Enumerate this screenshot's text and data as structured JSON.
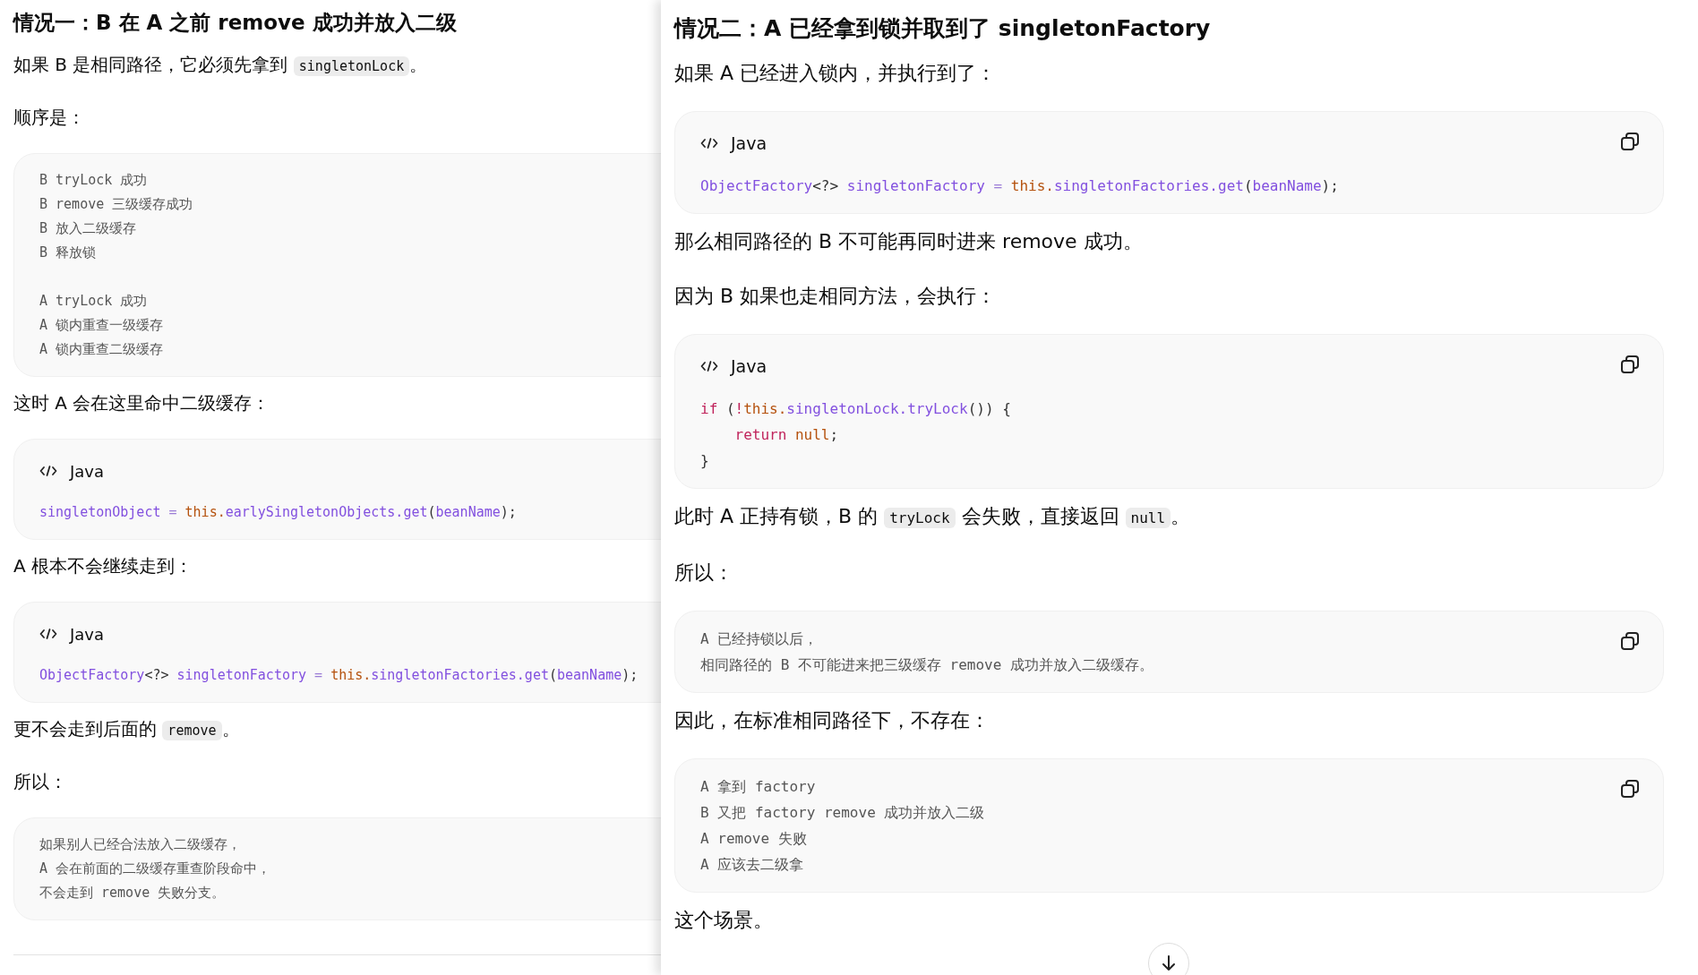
{
  "left_panel": {
    "blocks": [
      {
        "kind": "heading",
        "text": "情况一：B 在 A 之前 remove 成功并放入二级"
      },
      {
        "kind": "paragraph",
        "parts": [
          {
            "kind": "text",
            "text": "如果 B 是相同路径，它必须先拿到 "
          },
          {
            "kind": "code",
            "text": "singletonLock"
          },
          {
            "kind": "text",
            "text": "。"
          }
        ]
      },
      {
        "kind": "paragraph",
        "parts": [
          {
            "kind": "text",
            "text": "顺序是："
          }
        ]
      },
      {
        "kind": "plain_code",
        "copy_button": false,
        "groups": [
          [
            "B tryLock 成功",
            "B remove 三级缓存成功",
            "B 放入二级缓存",
            "B 释放锁"
          ],
          [
            "A tryLock 成功",
            "A 锁内重查一级缓存",
            "A 锁内重查二级缓存"
          ]
        ]
      },
      {
        "kind": "paragraph",
        "parts": [
          {
            "kind": "text",
            "text": "这时 A 会在这里命中二级缓存："
          }
        ]
      },
      {
        "kind": "code",
        "language": "Java",
        "copy_button": false,
        "lines": [
          [
            {
              "kind": "ident",
              "text": "singletonObject"
            },
            {
              "kind": "op",
              "text": " = "
            },
            {
              "kind": "this",
              "text": "this."
            },
            {
              "kind": "ident",
              "text": "earlySingletonObjects.get"
            },
            {
              "kind": "punct",
              "text": "("
            },
            {
              "kind": "ident",
              "text": "beanName"
            },
            {
              "kind": "punct",
              "text": ");"
            }
          ]
        ]
      },
      {
        "kind": "paragraph",
        "parts": [
          {
            "kind": "text",
            "text": "A 根本不会继续走到："
          }
        ]
      },
      {
        "kind": "code",
        "language": "Java",
        "copy_button": false,
        "lines": [
          [
            {
              "kind": "ident",
              "text": "ObjectFactory"
            },
            {
              "kind": "punct",
              "text": "<?> "
            },
            {
              "kind": "ident",
              "text": "singletonFactory"
            },
            {
              "kind": "op",
              "text": " = "
            },
            {
              "kind": "this",
              "text": "this."
            },
            {
              "kind": "ident",
              "text": "singletonFactories.get"
            },
            {
              "kind": "punct",
              "text": "("
            },
            {
              "kind": "ident",
              "text": "beanName"
            },
            {
              "kind": "punct",
              "text": ");"
            }
          ]
        ]
      },
      {
        "kind": "paragraph",
        "parts": [
          {
            "kind": "text",
            "text": "更不会走到后面的 "
          },
          {
            "kind": "code",
            "text": "remove"
          },
          {
            "kind": "text",
            "text": "。"
          }
        ]
      },
      {
        "kind": "paragraph",
        "parts": [
          {
            "kind": "text",
            "text": "所以："
          }
        ]
      },
      {
        "kind": "plain_code",
        "copy_button": false,
        "groups": [
          [
            "如果别人已经合法放入二级缓存，",
            "A 会在前面的二级缓存重查阶段命中，",
            "不会走到 remove 失败分支。"
          ]
        ]
      },
      {
        "kind": "divider"
      }
    ]
  },
  "right_panel": {
    "blocks": [
      {
        "kind": "heading",
        "text": "情况二：A 已经拿到锁并取到了 singletonFactory"
      },
      {
        "kind": "paragraph",
        "parts": [
          {
            "kind": "text",
            "text": "如果 A 已经进入锁内，并执行到了："
          }
        ]
      },
      {
        "kind": "code",
        "language": "Java",
        "copy_button": true,
        "lines": [
          [
            {
              "kind": "ident",
              "text": "ObjectFactory"
            },
            {
              "kind": "punct",
              "text": "<?> "
            },
            {
              "kind": "ident",
              "text": "singletonFactory"
            },
            {
              "kind": "op",
              "text": " = "
            },
            {
              "kind": "this",
              "text": "this."
            },
            {
              "kind": "ident",
              "text": "singletonFactories.get"
            },
            {
              "kind": "punct",
              "text": "("
            },
            {
              "kind": "ident",
              "text": "beanName"
            },
            {
              "kind": "punct",
              "text": ");"
            }
          ]
        ]
      },
      {
        "kind": "paragraph",
        "parts": [
          {
            "kind": "text",
            "text": "那么相同路径的 B 不可能再同时进来 remove 成功。"
          }
        ]
      },
      {
        "kind": "paragraph",
        "parts": [
          {
            "kind": "text",
            "text": "因为 B 如果也走相同方法，会执行："
          }
        ]
      },
      {
        "kind": "code",
        "language": "Java",
        "copy_button": true,
        "lines": [
          [
            {
              "kind": "kw",
              "text": "if"
            },
            {
              "kind": "punct",
              "text": " ("
            },
            {
              "kind": "kw",
              "text": "!"
            },
            {
              "kind": "this",
              "text": "this."
            },
            {
              "kind": "ident",
              "text": "singletonLock.tryLock"
            },
            {
              "kind": "punct",
              "text": "()) {"
            }
          ],
          [
            {
              "kind": "kw",
              "text": "    return "
            },
            {
              "kind": "this",
              "text": "null"
            },
            {
              "kind": "punct",
              "text": ";"
            }
          ],
          [
            {
              "kind": "punct",
              "text": "}"
            }
          ]
        ]
      },
      {
        "kind": "paragraph",
        "parts": [
          {
            "kind": "text",
            "text": "此时 A 正持有锁，B 的 "
          },
          {
            "kind": "code",
            "text": "tryLock"
          },
          {
            "kind": "text",
            "text": " 会失败，直接返回 "
          },
          {
            "kind": "code",
            "text": "null"
          },
          {
            "kind": "text",
            "text": "。"
          }
        ]
      },
      {
        "kind": "paragraph",
        "parts": [
          {
            "kind": "text",
            "text": "所以："
          }
        ]
      },
      {
        "kind": "plain_code",
        "copy_button": true,
        "groups": [
          [
            "A 已经持锁以后，",
            "相同路径的 B 不可能进来把三级缓存 remove 成功并放入二级缓存。"
          ]
        ]
      },
      {
        "kind": "paragraph",
        "parts": [
          {
            "kind": "text",
            "text": "因此，在标准相同路径下，不存在："
          }
        ]
      },
      {
        "kind": "plain_code",
        "copy_button": true,
        "groups": [
          [
            "A 拿到 factory",
            "B 又把 factory remove 成功并放入二级",
            "A remove 失败",
            "A 应该去二级拿"
          ]
        ]
      },
      {
        "kind": "paragraph",
        "parts": [
          {
            "kind": "text",
            "text": "这个场景。"
          }
        ]
      }
    ]
  }
}
